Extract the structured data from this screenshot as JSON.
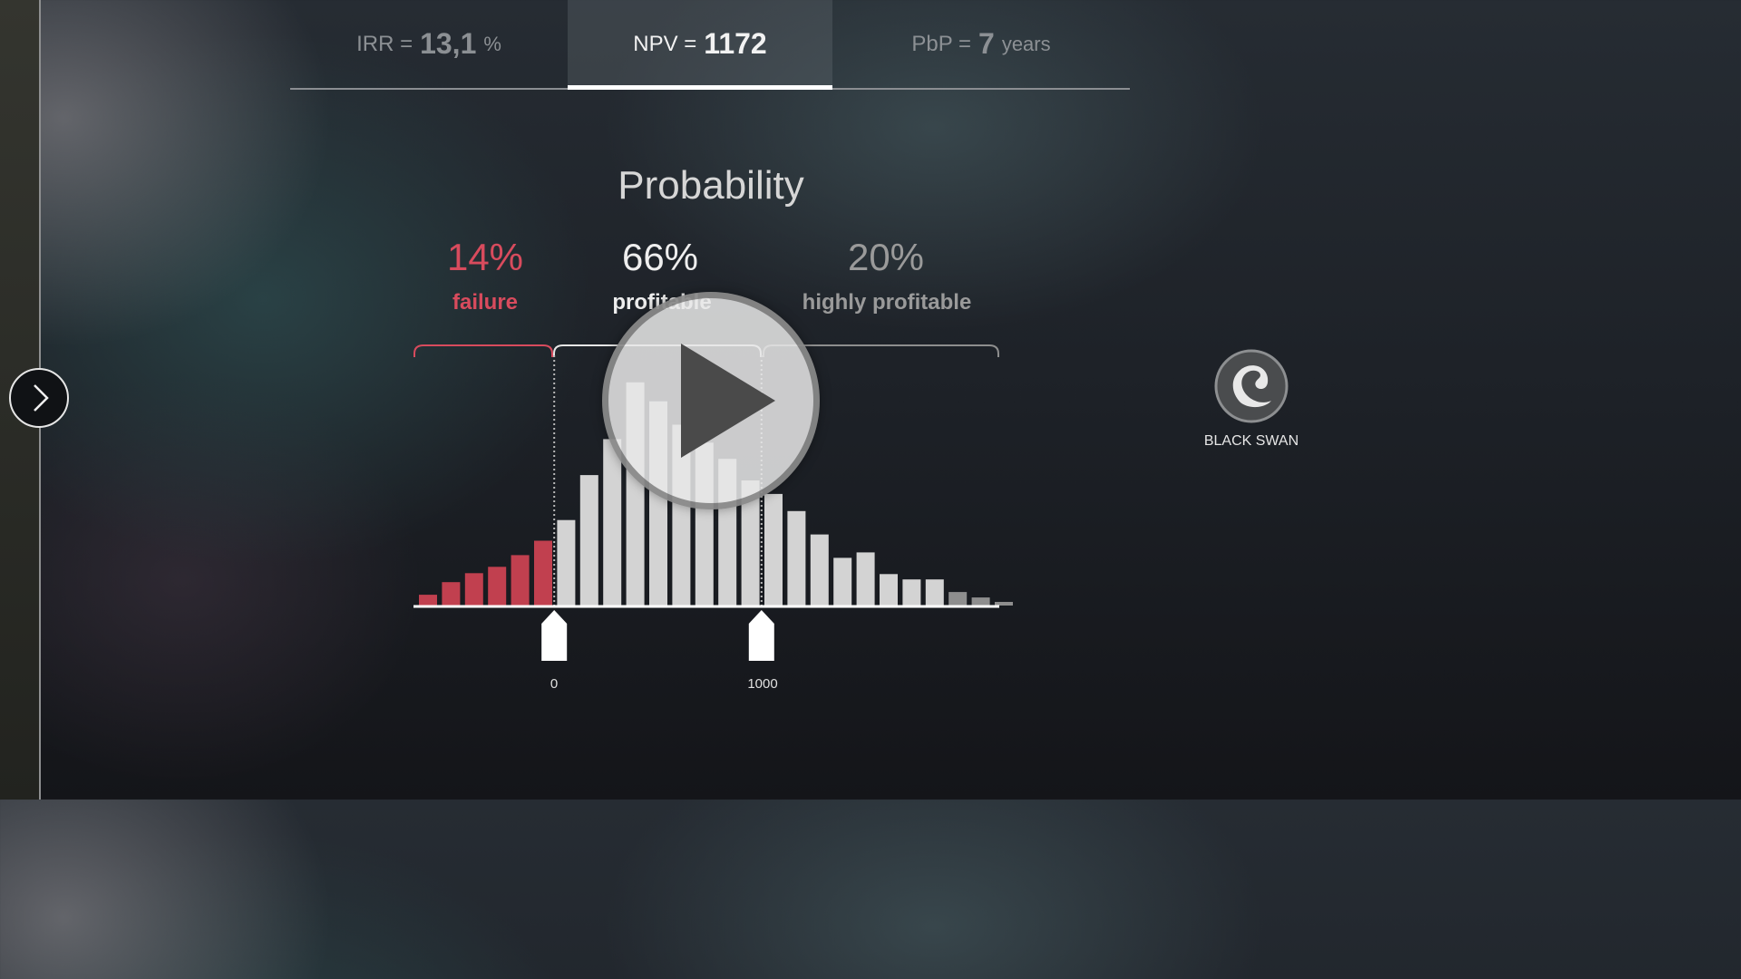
{
  "metrics": {
    "irr": {
      "label": "IRR =",
      "value": "13,1",
      "unit": "%"
    },
    "npv": {
      "label": "NPV =",
      "value": "1172"
    },
    "pbp": {
      "label": "PbP =",
      "value": "7",
      "unit": "years"
    }
  },
  "probability": {
    "title": "Probability",
    "segments": [
      {
        "percent": "14%",
        "label": "failure"
      },
      {
        "percent": "66%",
        "label": "profitable"
      },
      {
        "percent": "20%",
        "label": "highly profitable"
      }
    ]
  },
  "colors": {
    "failure": "#c1404f",
    "profitable": "#d3d3d3",
    "highly_profitable": "#d3d3d3",
    "tail": "#8e8e8e"
  },
  "chart_data": {
    "type": "bar",
    "values": [
      12,
      26,
      36,
      43,
      56,
      72,
      95,
      145,
      185,
      248,
      227,
      201,
      181,
      163,
      139,
      124,
      105,
      79,
      53,
      59,
      35,
      29,
      29,
      15,
      9,
      4
    ],
    "groups": [
      "failure",
      "failure",
      "failure",
      "failure",
      "failure",
      "failure",
      "profitable",
      "profitable",
      "profitable",
      "profitable",
      "profitable",
      "profitable",
      "profitable",
      "profitable",
      "profitable",
      "highly_profitable",
      "highly_profitable",
      "highly_profitable",
      "highly_profitable",
      "highly_profitable",
      "highly_profitable",
      "highly_profitable",
      "highly_profitable",
      "tail",
      "tail",
      "tail"
    ],
    "markers": [
      {
        "label": "0",
        "after_bar": 6
      },
      {
        "label": "1000",
        "after_bar": 15
      }
    ],
    "ylim": [
      0,
      270
    ]
  },
  "brand": {
    "name": "BLACK SWAN",
    "logo_icon": "swan-logo-icon"
  },
  "controls": {
    "next_icon": "chevron-right-icon",
    "play_icon": "play-icon"
  }
}
